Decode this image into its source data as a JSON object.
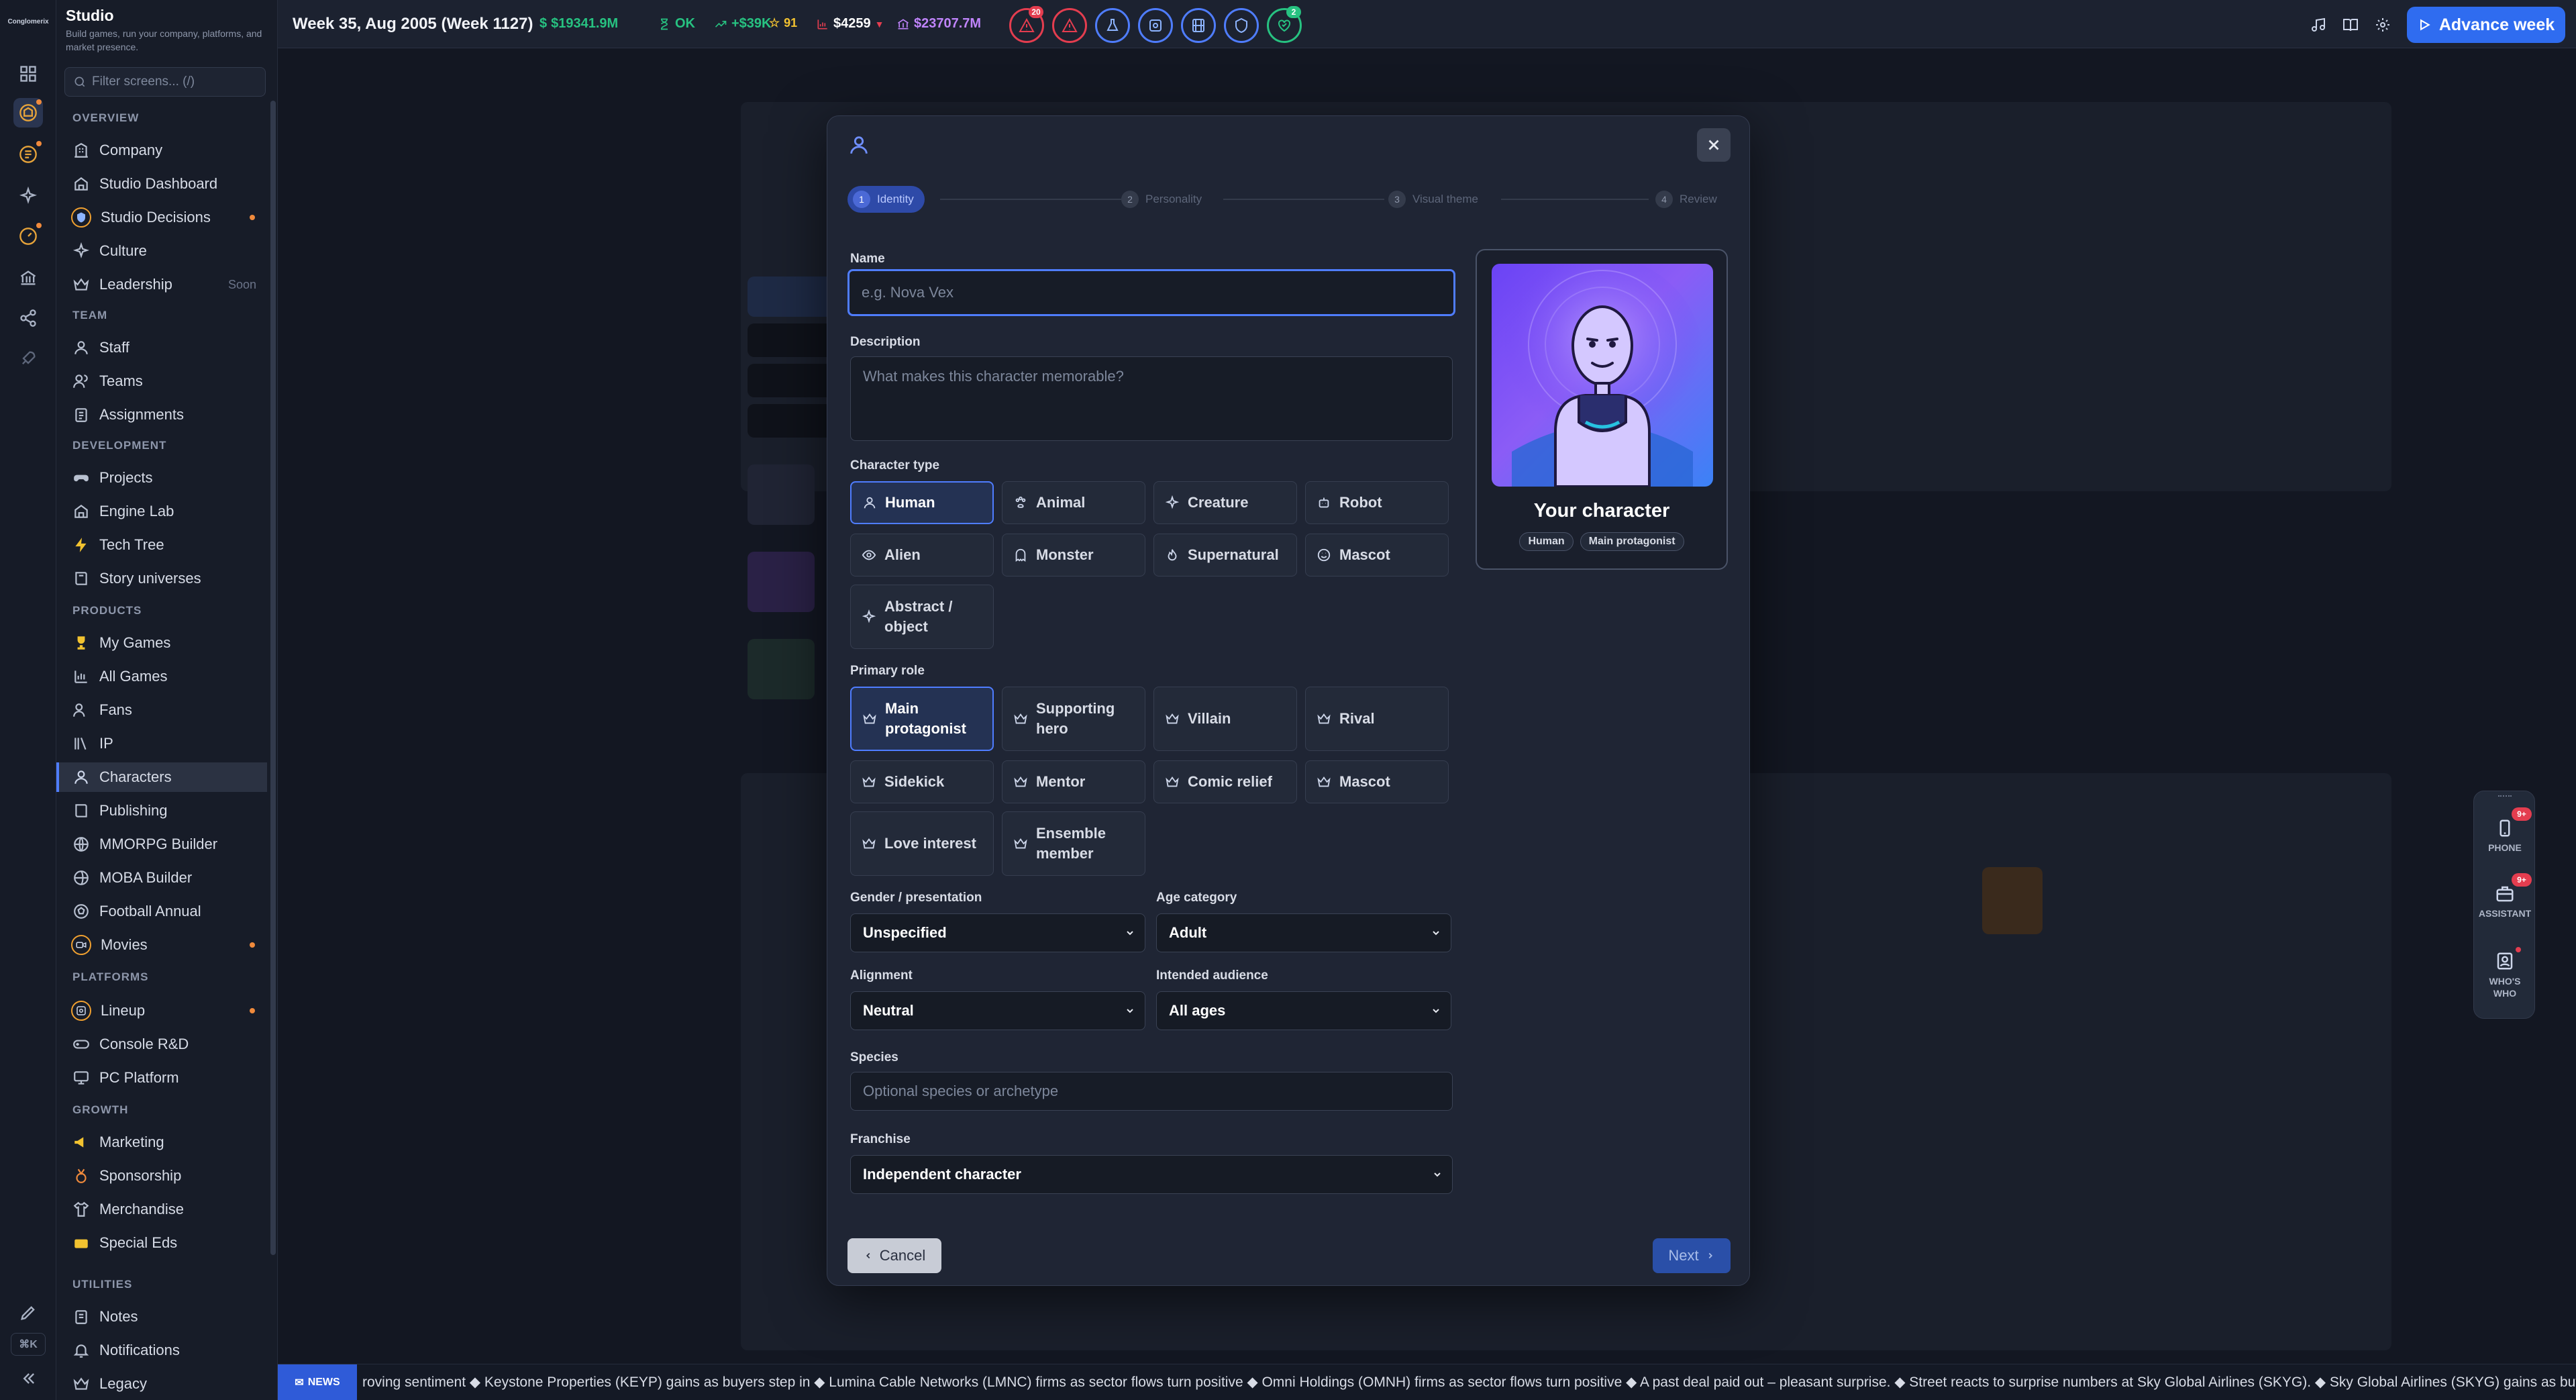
{
  "app": {
    "logo_text": "Conglomerix"
  },
  "sidebar": {
    "title": "Studio",
    "subtitle": "Build games, run your company, platforms, and market presence.",
    "filter_placeholder": "Filter screens... (/)",
    "sections": {
      "overview": "OVERVIEW",
      "team": "TEAM",
      "development": "DEVELOPMENT",
      "products": "PRODUCTS",
      "platforms": "PLATFORMS",
      "growth": "GROWTH",
      "utilities": "UTILITIES"
    },
    "items": {
      "company": "Company",
      "studio_dashboard": "Studio Dashboard",
      "studio_decisions": "Studio Decisions",
      "culture": "Culture",
      "leadership": "Leadership",
      "leadership_tag": "Soon",
      "staff": "Staff",
      "teams": "Teams",
      "assignments": "Assignments",
      "projects": "Projects",
      "engine_lab": "Engine Lab",
      "tech_tree": "Tech Tree",
      "story_universes": "Story universes",
      "my_games": "My Games",
      "all_games": "All Games",
      "fans": "Fans",
      "ip": "IP",
      "characters": "Characters",
      "publishing": "Publishing",
      "mmorpg_builder": "MMORPG Builder",
      "moba_builder": "MOBA Builder",
      "football_annual": "Football Annual",
      "movies": "Movies",
      "lineup": "Lineup",
      "console_rd": "Console R&D",
      "pc_platform": "PC Platform",
      "marketing": "Marketing",
      "sponsorship": "Sponsorship",
      "merchandise": "Merchandise",
      "special_eds": "Special Eds",
      "notes": "Notes",
      "notifications": "Notifications",
      "legacy": "Legacy"
    }
  },
  "rail": {
    "shortcut": "⌘K"
  },
  "topbar": {
    "week": "Week 35, Aug 2005 (Week 1127)",
    "cash": "$19341.9M",
    "status": "OK",
    "delta": "+$39K",
    "stars": "91",
    "price": "$4259",
    "valuation": "$23707.7M",
    "alert_count_1": "20",
    "alert_count_2": "2",
    "advance_label": "Advance week"
  },
  "modal": {
    "steps": [
      {
        "num": "1",
        "label": "Identity"
      },
      {
        "num": "2",
        "label": "Personality"
      },
      {
        "num": "3",
        "label": "Visual theme"
      },
      {
        "num": "4",
        "label": "Review"
      }
    ],
    "name_label": "Name",
    "name_placeholder": "e.g. Nova Vex",
    "description_label": "Description",
    "description_placeholder": "What makes this character memorable?",
    "character_type_label": "Character type",
    "character_types": [
      "Human",
      "Animal",
      "Creature",
      "Robot",
      "Alien",
      "Monster",
      "Supernatural",
      "Mascot",
      "Abstract / object"
    ],
    "primary_role_label": "Primary role",
    "roles": [
      "Main protagonist",
      "Supporting hero",
      "Villain",
      "Rival",
      "Sidekick",
      "Mentor",
      "Comic relief",
      "Mascot",
      "Love interest",
      "Ensemble member"
    ],
    "gender_label": "Gender / presentation",
    "gender_value": "Unspecified",
    "age_label": "Age category",
    "age_value": "Adult",
    "alignment_label": "Alignment",
    "alignment_value": "Neutral",
    "audience_label": "Intended audience",
    "audience_value": "All ages",
    "species_label": "Species",
    "species_placeholder": "Optional species or archetype",
    "franchise_label": "Franchise",
    "franchise_value": "Independent character",
    "preview_title": "Your character",
    "preview_chip_type": "Human",
    "preview_chip_role": "Main protagonist",
    "cancel_label": "Cancel",
    "next_label": "Next"
  },
  "dock": {
    "phone": "PHONE",
    "assistant": "ASSISTANT",
    "whos_who": "WHO'S WHO",
    "phone_badge": "9+",
    "assistant_badge": "9+"
  },
  "ticker": {
    "tag": "NEWS",
    "text": "roving sentiment ◆ Keystone Properties (KEYP) gains as buyers step in ◆ Lumina Cable Networks (LMNC) firms as sector flows turn positive ◆ Omni Holdings (OMNH) firms as sector flows turn positive ◆ A past deal paid out – pleasant surprise. ◆ Street reacts to surprise numbers at Sky Global Airlines (SKYG). ◆ Sky Global Airlines (SKYG) gains as buyers step in ◆ Apex Semicondu"
  },
  "colors": {
    "accent": "#2f6cf0",
    "danger": "#e43d4f",
    "success": "#27c281",
    "warning": "#f0a030"
  }
}
